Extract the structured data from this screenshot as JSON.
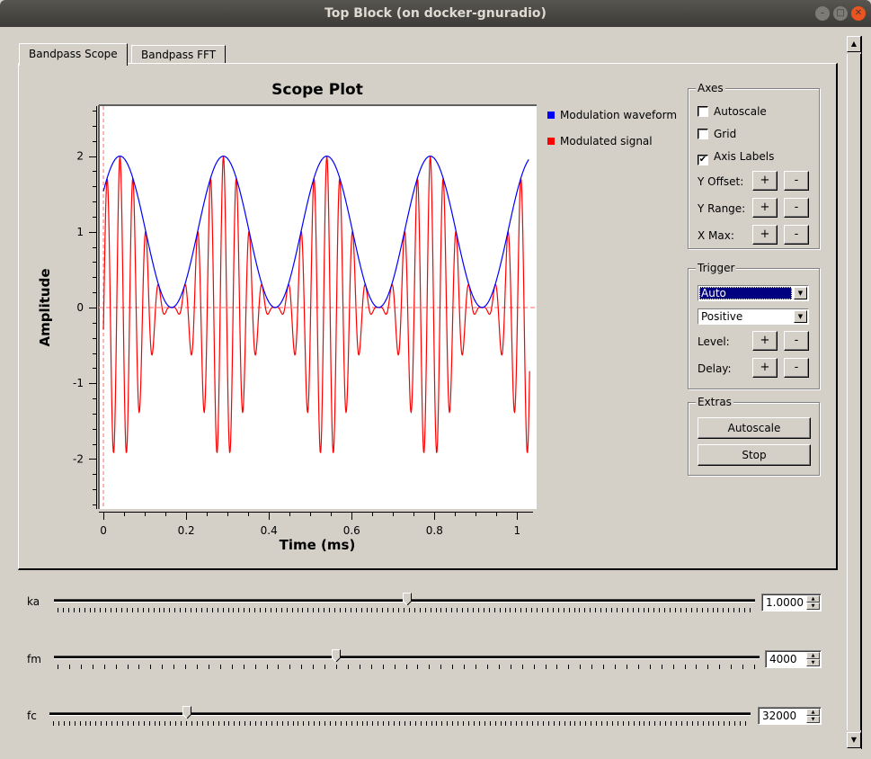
{
  "window": {
    "title": "Top Block (on docker-gnuradio)",
    "controls": [
      "minimize",
      "maximize",
      "close"
    ]
  },
  "tabs": [
    {
      "label": "Bandpass Scope",
      "active": true
    },
    {
      "label": "Bandpass FFT",
      "active": false
    }
  ],
  "chart_data": {
    "type": "line",
    "title": "Scope Plot",
    "xlabel": "Time (ms)",
    "ylabel": "Amplitude",
    "xlim": [
      -0.011,
      1.047
    ],
    "ylim": [
      -2.66,
      2.66
    ],
    "xticks": [
      0,
      0.2,
      0.4,
      0.6,
      0.8,
      1
    ],
    "xtick_labels": [
      "0",
      "0.2",
      "0.4",
      "0.6",
      "0.8",
      "1"
    ],
    "yticks": [
      -2,
      -1,
      0,
      1,
      2
    ],
    "ytick_labels": [
      "-2",
      "-1",
      "0",
      "1",
      "2"
    ],
    "grid": false,
    "legend_position": "right",
    "trigger_marker_x": 0,
    "series": [
      {
        "name": "Modulation waveform",
        "color": "#0000ff",
        "formula": "1 + ka*cos(2*pi*fm*(t - 0.04ms))",
        "x_range": [
          0,
          1.03
        ]
      },
      {
        "name": "Modulated signal",
        "color": "#ff0000",
        "formula": "envelope * cos(2*pi*fc*(t - 0.04ms))",
        "x_range": [
          0,
          1.03
        ]
      }
    ],
    "params": {
      "ka": 1.0,
      "fm_hz": 4000,
      "fc_hz": 32000,
      "peak_t_ms": 0.04
    }
  },
  "legend": [
    {
      "label": "Modulation waveform",
      "color": "#0000ff"
    },
    {
      "label": "Modulated signal",
      "color": "#ff0000"
    }
  ],
  "axes_group": {
    "title": "Axes",
    "autoscale": {
      "label": "Autoscale",
      "checked": false
    },
    "grid": {
      "label": "Grid",
      "checked": false
    },
    "axis_labels": {
      "label": "Axis Labels",
      "checked": true
    },
    "rows": [
      {
        "label": "Y Offset:",
        "plus": "+",
        "minus": "-"
      },
      {
        "label": "Y Range:",
        "plus": "+",
        "minus": "-"
      },
      {
        "label": "X Max:",
        "plus": "+",
        "minus": "-"
      }
    ]
  },
  "trigger_group": {
    "title": "Trigger",
    "mode": "Auto",
    "slope": "Positive",
    "rows": [
      {
        "label": "Level:",
        "plus": "+",
        "minus": "-"
      },
      {
        "label": "Delay:",
        "plus": "+",
        "minus": "-"
      }
    ]
  },
  "extras_group": {
    "title": "Extras",
    "autoscale_label": "Autoscale",
    "stop_label": "Stop"
  },
  "sliders": [
    {
      "name": "ka",
      "label": "ka",
      "value": "1.0000",
      "fraction": 0.504
    },
    {
      "name": "fm",
      "label": "fm",
      "value": "4000",
      "fraction": 0.4
    },
    {
      "name": "fc",
      "label": "fc",
      "value": "32000",
      "fraction": 0.196
    }
  ]
}
